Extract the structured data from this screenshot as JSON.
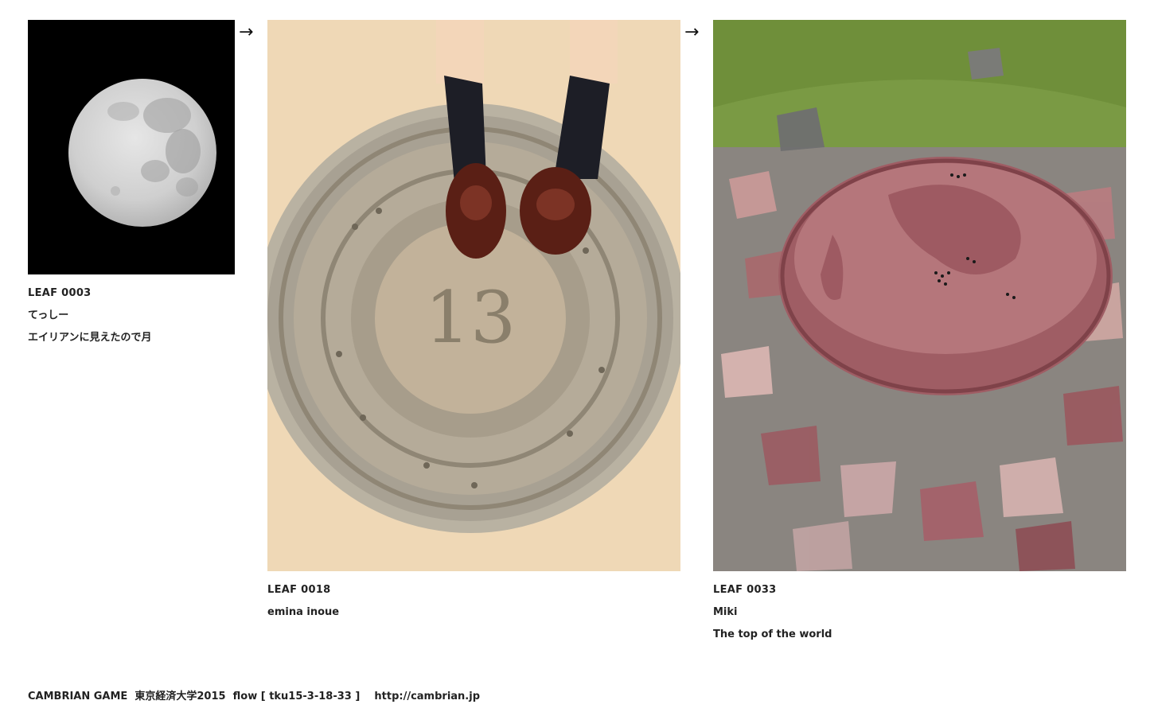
{
  "leaves": [
    {
      "id": "LEAF 0003",
      "author": "てっしー",
      "comment": "エイリアンに見えたので月",
      "image": "full-moon-photo"
    },
    {
      "id": "LEAF 0018",
      "author": "emina inoue",
      "comment": "",
      "image": "manhole-cover-with-loafers-photo"
    },
    {
      "id": "LEAF 0033",
      "author": "Miki",
      "comment": "The top of the world",
      "image": "stone-world-map-plaza-photo"
    }
  ],
  "flow_arrows": [
    "→",
    "→"
  ],
  "footer": {
    "title": "CAMBRIAN GAME",
    "course": "東京経済大学2015",
    "flow": "flow [ tku15-3-18-33 ]",
    "url": "http://cambrian.jp"
  },
  "colors": {
    "text": "#222222",
    "background": "#ffffff"
  }
}
